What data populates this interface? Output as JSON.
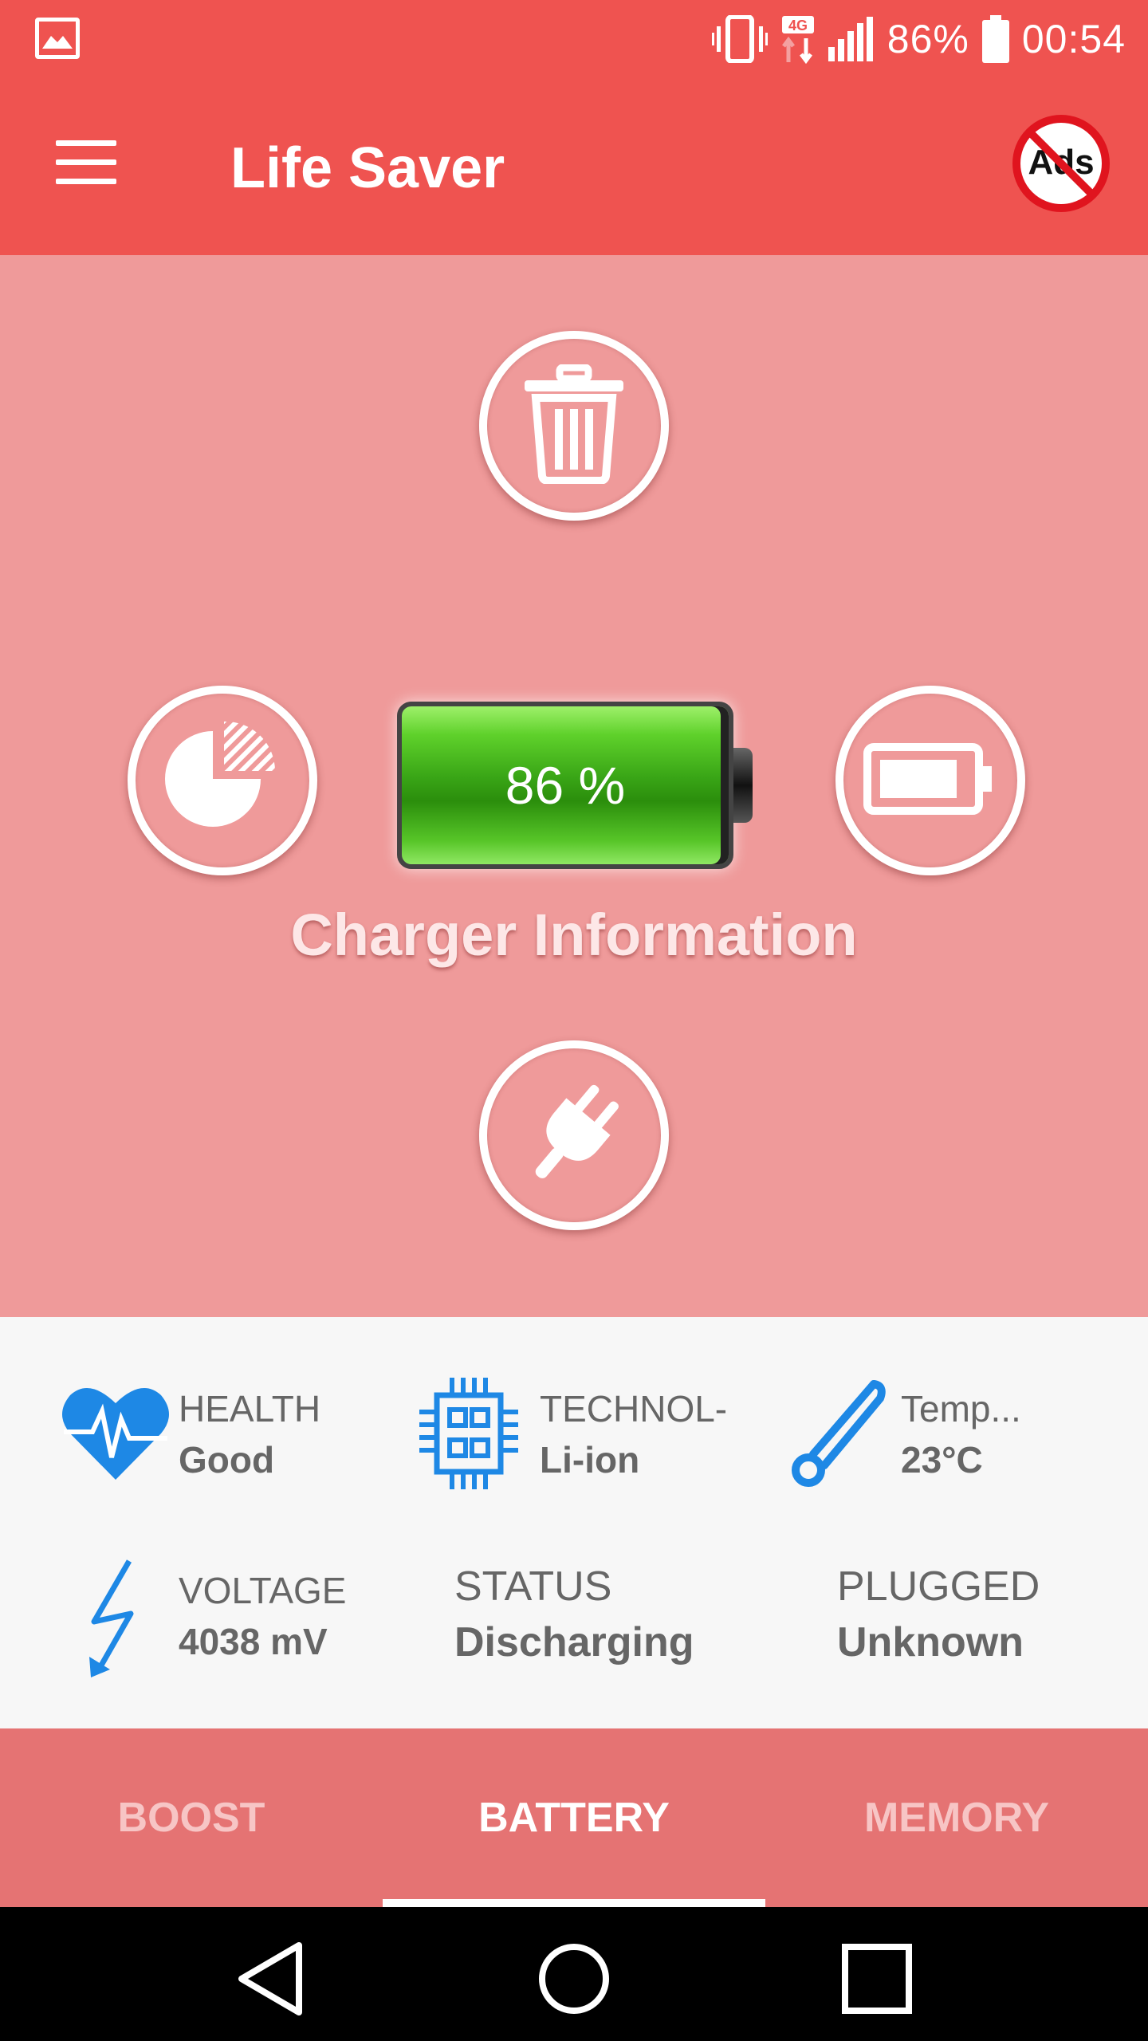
{
  "status_bar": {
    "battery_percent_text": "86%",
    "time": "00:54",
    "network_label": "4G",
    "icons": [
      "gallery-icon",
      "vibrate-icon",
      "data-4g-icon",
      "signal-icon",
      "battery-status-icon"
    ]
  },
  "app_bar": {
    "title": "Life Saver",
    "no_ads_label": "Ads",
    "icons": [
      "menu-icon",
      "no-ads-icon"
    ]
  },
  "battery": {
    "percent_text": "86 %",
    "level": 0.86,
    "section_title": "Charger Information"
  },
  "action_icons": [
    "trash-icon",
    "pie-chart-icon",
    "battery-icon",
    "plug-icon"
  ],
  "info": {
    "health": {
      "label": "HEALTH",
      "value": "Good",
      "icon": "heart-pulse-icon"
    },
    "technology": {
      "label": "TECHNOL-",
      "value": "Li-ion",
      "icon": "chip-icon"
    },
    "temperature": {
      "label": "Temp...",
      "value": "23°C",
      "icon": "thermometer-icon"
    },
    "voltage": {
      "label": "VOLTAGE",
      "value": "4038 mV",
      "icon": "lightning-icon"
    },
    "status": {
      "label": "STATUS",
      "value": "Discharging"
    },
    "plugged": {
      "label": "PLUGGED",
      "value": "Unknown"
    }
  },
  "tabs": [
    {
      "label": "BOOST",
      "active": false
    },
    {
      "label": "BATTERY",
      "active": true
    },
    {
      "label": "MEMORY",
      "active": false
    }
  ],
  "nav": {
    "icons": [
      "back-icon",
      "home-icon",
      "recents-icon"
    ]
  },
  "colors": {
    "primary": "#ef5350",
    "main_bg": "#ef9a9a",
    "tab_bg": "#e57373",
    "info_icon_blue": "#1e88e5",
    "battery_green": "#43b51a"
  }
}
